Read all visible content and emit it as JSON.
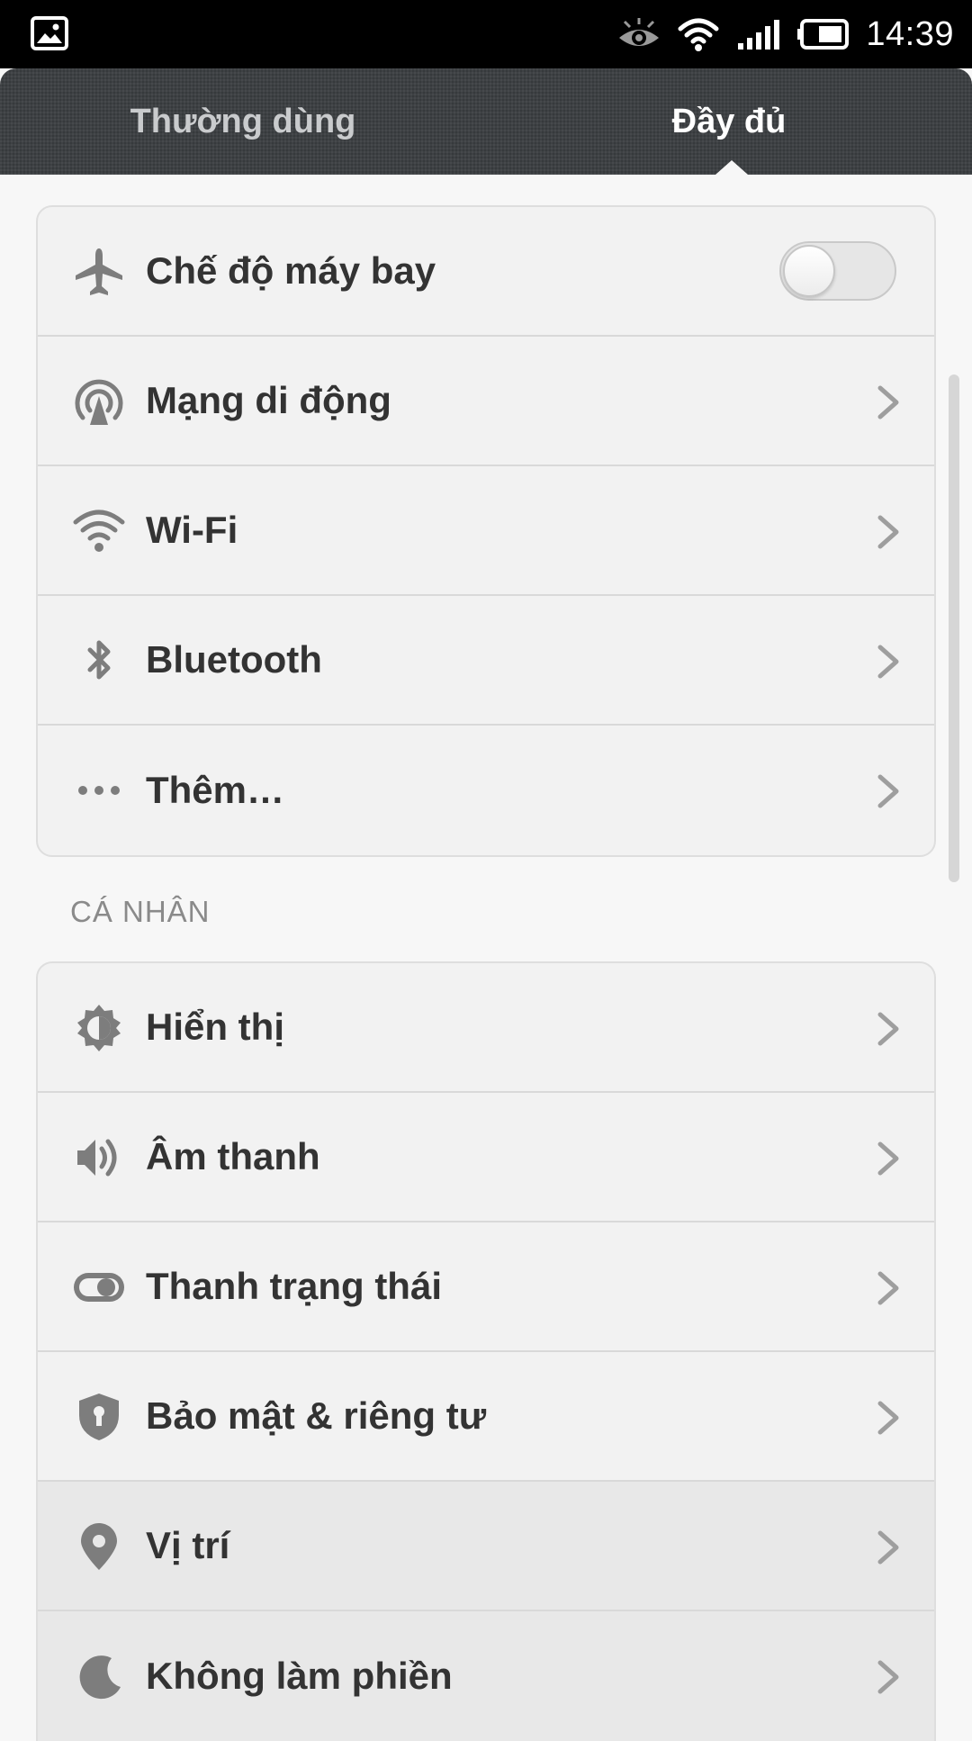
{
  "status_bar": {
    "time": "14:39",
    "left_icon": "gallery-notification-icon",
    "icons": [
      "eye-icon",
      "wifi-icon",
      "signal-icon",
      "battery-icon"
    ]
  },
  "tabs": [
    {
      "label": "Thường dùng",
      "selected": false
    },
    {
      "label": "Đầy đủ",
      "selected": true
    }
  ],
  "network_group": {
    "items": [
      {
        "label": "Chế độ máy bay",
        "icon": "airplane-icon",
        "control": "toggle",
        "toggle_on": false
      },
      {
        "label": "Mạng di động",
        "icon": "cellular-antenna-icon",
        "control": "chevron"
      },
      {
        "label": "Wi-Fi",
        "icon": "wifi-icon",
        "control": "chevron"
      },
      {
        "label": "Bluetooth",
        "icon": "bluetooth-icon",
        "control": "chevron"
      },
      {
        "label": "Thêm…",
        "icon": "more-dots-icon",
        "control": "chevron"
      }
    ]
  },
  "personal_section": {
    "header": "CÁ NHÂN",
    "items": [
      {
        "label": "Hiển thị",
        "icon": "brightness-icon",
        "control": "chevron"
      },
      {
        "label": "Âm thanh",
        "icon": "speaker-icon",
        "control": "chevron"
      },
      {
        "label": "Thanh trạng thái",
        "icon": "status-bar-toggle-icon",
        "control": "chevron"
      },
      {
        "label": "Bảo mật & riêng tư",
        "icon": "shield-lock-icon",
        "control": "chevron"
      },
      {
        "label": "Vị trí",
        "icon": "location-pin-icon",
        "control": "chevron"
      },
      {
        "label": "Không làm phiền",
        "icon": "moon-icon",
        "control": "chevron"
      }
    ]
  },
  "colors": {
    "tab_bar_bg": "#3a3d40",
    "page_bg": "#f7f7f7",
    "card_bg": "#f2f2f2",
    "label_text": "#333333",
    "icon_gray": "#7d7d7d"
  }
}
